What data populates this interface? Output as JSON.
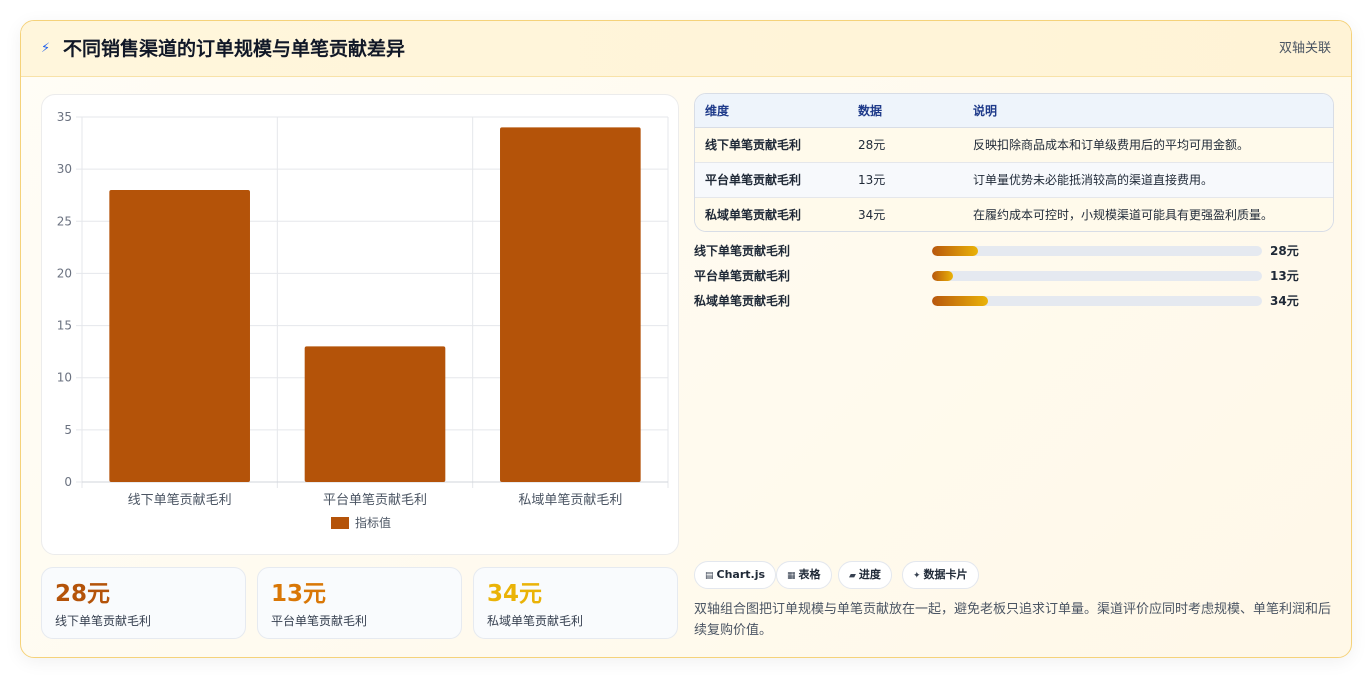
{
  "header": {
    "title": "不同销售渠道的订单规模与单笔贡献差异",
    "tag": "双轴关联"
  },
  "colors": {
    "bar": "#b45309",
    "kpi": [
      "#b45309",
      "#d97706",
      "#eab308"
    ]
  },
  "chart_data": {
    "type": "bar",
    "categories": [
      "线下单笔贡献毛利",
      "平台单笔贡献毛利",
      "私域单笔贡献毛利"
    ],
    "series": [
      {
        "name": "指标值",
        "values": [
          28,
          13,
          34
        ]
      }
    ],
    "ylim": [
      0,
      35
    ],
    "yticks": [
      0,
      5,
      10,
      15,
      20,
      25,
      30,
      35
    ],
    "grid": true,
    "legend": "bottom"
  },
  "kpis": [
    {
      "value": "28元",
      "label": "线下单笔贡献毛利"
    },
    {
      "value": "13元",
      "label": "平台单笔贡献毛利"
    },
    {
      "value": "34元",
      "label": "私域单笔贡献毛利"
    }
  ],
  "table": {
    "headers": [
      "维度",
      "数据",
      "说明"
    ],
    "rows": [
      {
        "dim": "线下单笔贡献毛利",
        "value": "28元",
        "desc": "反映扣除商品成本和订单级费用后的平均可用金额。"
      },
      {
        "dim": "平台单笔贡献毛利",
        "value": "13元",
        "desc": "订单量优势未必能抵消较高的渠道直接费用。"
      },
      {
        "dim": "私域单笔贡献毛利",
        "value": "34元",
        "desc": "在履约成本可控时，小规模渠道可能具有更强盈利质量。"
      }
    ]
  },
  "progress": [
    {
      "label": "线下单笔贡献毛利",
      "value": "28元",
      "fraction": 0.14
    },
    {
      "label": "平台单笔贡献毛利",
      "value": "13元",
      "fraction": 0.065
    },
    {
      "label": "私域单笔贡献毛利",
      "value": "34元",
      "fraction": 0.17
    }
  ],
  "chips": [
    {
      "icon": "chart-icon",
      "glyph": "▤",
      "label": "Chart.js"
    },
    {
      "icon": "table-icon",
      "glyph": "▦",
      "label": "表格"
    },
    {
      "icon": "progress-icon",
      "glyph": "▰",
      "label": "进度"
    },
    {
      "icon": "sparkle-icon",
      "glyph": "✦",
      "label": "数据卡片"
    }
  ],
  "note": "双轴组合图把订单规模与单笔贡献放在一起，避免老板只追求订单量。渠道评价应同时考虑规模、单笔利润和后续复购价值。"
}
